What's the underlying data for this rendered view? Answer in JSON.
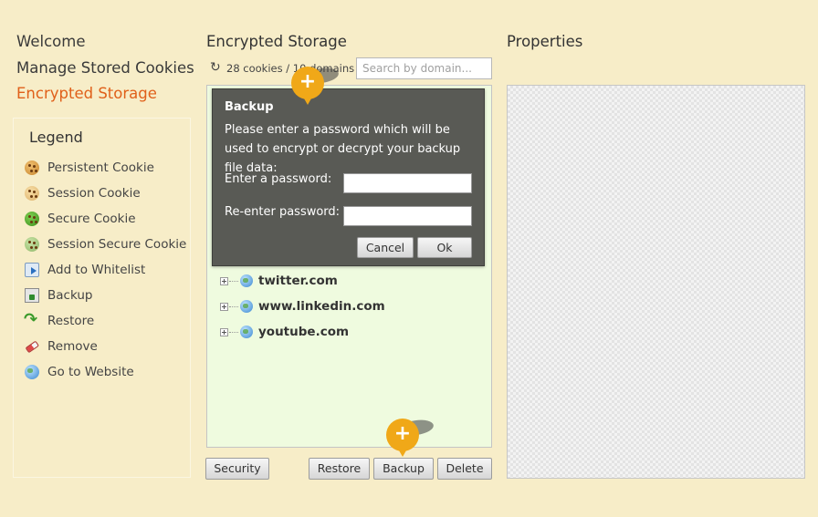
{
  "nav": {
    "items": [
      {
        "label": "Welcome",
        "active": false
      },
      {
        "label": "Manage Stored Cookies",
        "active": false
      },
      {
        "label": "Encrypted Storage",
        "active": true
      }
    ]
  },
  "legend": {
    "title": "Legend",
    "items": [
      {
        "label": "Persistent Cookie",
        "icon": "persistent-cookie-icon"
      },
      {
        "label": "Session Cookie",
        "icon": "session-cookie-icon"
      },
      {
        "label": "Secure Cookie",
        "icon": "secure-cookie-icon"
      },
      {
        "label": "Session Secure Cookie",
        "icon": "session-secure-cookie-icon"
      },
      {
        "label": "Add to Whitelist",
        "icon": "whitelist-icon"
      },
      {
        "label": "Backup",
        "icon": "backup-icon"
      },
      {
        "label": "Restore",
        "icon": "restore-icon"
      },
      {
        "label": "Remove",
        "icon": "remove-icon"
      },
      {
        "label": "Go to Website",
        "icon": "globe-icon"
      }
    ]
  },
  "storage": {
    "title": "Encrypted Storage",
    "count_text": "28 cookies / 10 domains",
    "search_placeholder": "Search by domain...",
    "domains": [
      "twitter.com",
      "www.linkedin.com",
      "youtube.com"
    ],
    "buttons": {
      "security": "Security",
      "restore": "Restore",
      "backup": "Backup",
      "delete": "Delete"
    }
  },
  "properties": {
    "title": "Properties"
  },
  "dialog": {
    "title": "Backup",
    "message": "Please enter a password which will be used to encrypt or decrypt your backup file data:",
    "password_label": "Enter a password:",
    "reenter_label": "Re-enter password:",
    "cancel": "Cancel",
    "ok": "Ok"
  },
  "tour_pin": {
    "symbol": "+",
    "color": "#f0a818"
  },
  "colors": {
    "background": "#f7edc8",
    "active_nav": "#e0601a",
    "tree_background": "#effbdf",
    "dialog_background": "#595a55"
  }
}
